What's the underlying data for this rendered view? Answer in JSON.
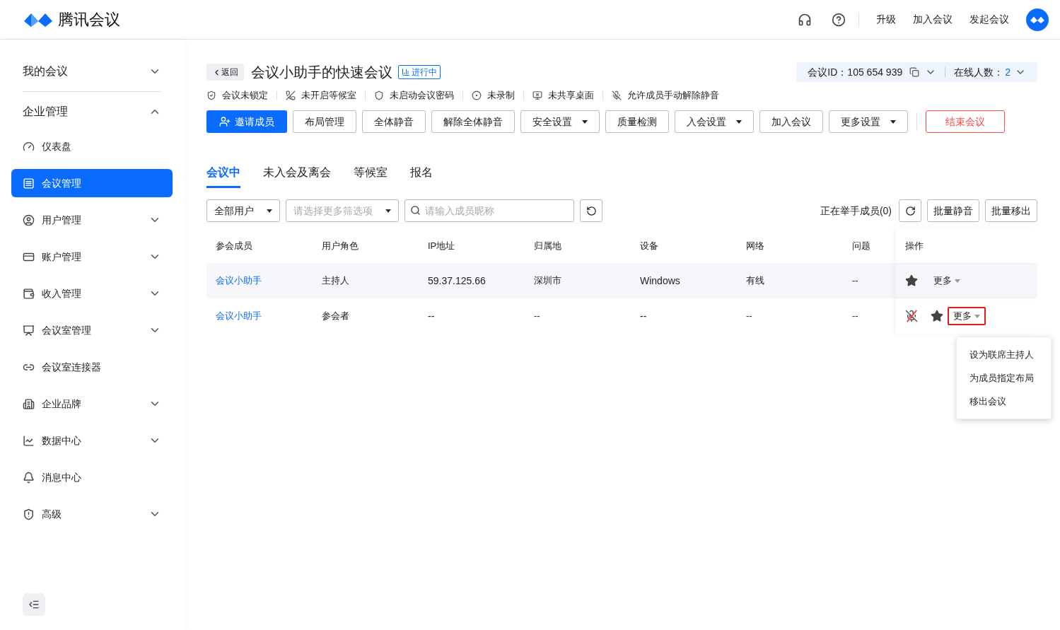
{
  "header": {
    "brand": "腾讯会议",
    "links": [
      "升级",
      "加入会议",
      "发起会议"
    ]
  },
  "sidebar": {
    "sections": [
      {
        "label": "我的会议",
        "expanded": false
      },
      {
        "label": "企业管理",
        "expanded": true,
        "items": [
          {
            "label": "仪表盘",
            "kind": "link",
            "selected": false
          },
          {
            "label": "会议管理",
            "kind": "link",
            "selected": true
          },
          {
            "label": "用户管理",
            "kind": "group",
            "selected": false
          },
          {
            "label": "账户管理",
            "kind": "group",
            "selected": false
          },
          {
            "label": "收入管理",
            "kind": "group",
            "selected": false
          },
          {
            "label": "会议室管理",
            "kind": "group",
            "selected": false
          },
          {
            "label": "会议室连接器",
            "kind": "link",
            "selected": false
          },
          {
            "label": "企业品牌",
            "kind": "group",
            "selected": false
          },
          {
            "label": "数据中心",
            "kind": "group",
            "selected": false
          },
          {
            "label": "消息中心",
            "kind": "link",
            "selected": false
          },
          {
            "label": "高级",
            "kind": "group",
            "selected": false
          }
        ]
      }
    ]
  },
  "meeting": {
    "back": "返回",
    "title": "会议小助手的快速会议",
    "status": "进行中",
    "id_label": "会议ID：",
    "id": "105 654 939",
    "online_label": "在线人数：",
    "online": "2",
    "states": [
      "会议未锁定",
      "未开启等候室",
      "未启动会议密码",
      "未录制",
      "未共享桌面",
      "允许成员手动解除静音"
    ]
  },
  "actions": [
    {
      "label": "邀请成员",
      "kind": "primary"
    },
    {
      "label": "布局管理",
      "kind": "plain"
    },
    {
      "label": "全体静音",
      "kind": "plain"
    },
    {
      "label": "解除全体静音",
      "kind": "plain"
    },
    {
      "label": "安全设置",
      "kind": "dropdown"
    },
    {
      "label": "质量检测",
      "kind": "plain"
    },
    {
      "label": "入会设置",
      "kind": "dropdown"
    },
    {
      "label": "加入会议",
      "kind": "plain"
    },
    {
      "label": "更多设置",
      "kind": "dropdown"
    },
    {
      "label": "结束会议",
      "kind": "danger"
    }
  ],
  "tabs": [
    {
      "label": "会议中",
      "selected": true
    },
    {
      "label": "未入会及离会",
      "selected": false
    },
    {
      "label": "等候室",
      "selected": false
    },
    {
      "label": "报名",
      "selected": false
    }
  ],
  "filters": {
    "user_type": "全部用户",
    "more_placeholder": "请选择更多筛选项",
    "search_placeholder": "请输入成员昵称",
    "raised_hands": "正在举手成员(0)",
    "batch": [
      "批量静音",
      "批量移出"
    ]
  },
  "table": {
    "columns": [
      "参会成员",
      "用户角色",
      "IP地址",
      "归属地",
      "设备",
      "网络",
      "问题",
      "操作"
    ],
    "rows": [
      {
        "cells": [
          "会议小助手",
          "主持人",
          "59.37.125.66",
          "深圳市",
          "Windows",
          "有线",
          "--"
        ],
        "muted": false,
        "more": "更多",
        "highlighted": false
      },
      {
        "cells": [
          "会议小助手",
          "参会者",
          "--",
          "--",
          "--",
          "--",
          "--"
        ],
        "muted": true,
        "more": "更多",
        "highlighted": true
      }
    ]
  },
  "menu": [
    "设为联席主持人",
    "为成员指定布局",
    "移出会议"
  ]
}
